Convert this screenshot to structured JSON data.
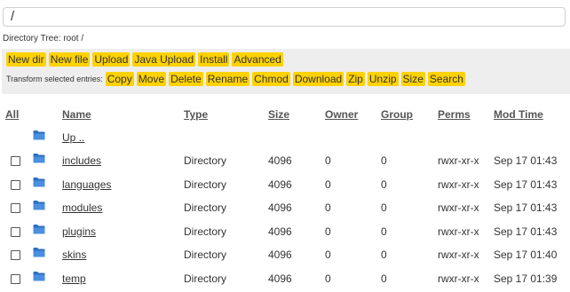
{
  "path": {
    "value": "/"
  },
  "directory_tree": {
    "label": "Directory Tree: root /"
  },
  "toolbar": {
    "row1": [
      "New dir",
      "New file",
      "Upload",
      "Java Upload",
      "Install",
      "Advanced"
    ],
    "transform_label": "Transform selected entries:",
    "row2": [
      "Copy",
      "Move",
      "Delete",
      "Rename",
      "Chmod",
      "Download",
      "Zip",
      "Unzip",
      "Size",
      "Search"
    ]
  },
  "table": {
    "headers": {
      "all": "All",
      "name": "Name",
      "type": "Type",
      "size": "Size",
      "owner": "Owner",
      "group": "Group",
      "perms": "Perms",
      "modtime": "Mod Time"
    },
    "up_label": "Up ..",
    "rows": [
      {
        "name": "includes",
        "type": "Directory",
        "size": "4096",
        "owner": "0",
        "group": "0",
        "perms": "rwxr-xr-x",
        "modtime": "Sep 17 01:43"
      },
      {
        "name": "languages",
        "type": "Directory",
        "size": "4096",
        "owner": "0",
        "group": "0",
        "perms": "rwxr-xr-x",
        "modtime": "Sep 17 01:43"
      },
      {
        "name": "modules",
        "type": "Directory",
        "size": "4096",
        "owner": "0",
        "group": "0",
        "perms": "rwxr-xr-x",
        "modtime": "Sep 17 01:43"
      },
      {
        "name": "plugins",
        "type": "Directory",
        "size": "4096",
        "owner": "0",
        "group": "0",
        "perms": "rwxr-xr-x",
        "modtime": "Sep 17 01:43"
      },
      {
        "name": "skins",
        "type": "Directory",
        "size": "4096",
        "owner": "0",
        "group": "0",
        "perms": "rwxr-xr-x",
        "modtime": "Sep 17 01:40"
      },
      {
        "name": "temp",
        "type": "Directory",
        "size": "4096",
        "owner": "0",
        "group": "0",
        "perms": "rwxr-xr-x",
        "modtime": "Sep 17 01:39"
      }
    ]
  },
  "colors": {
    "button_bg": "#ffd200",
    "toolbar_bg": "#eeeeee",
    "folder_icon": "#2e6fc0"
  },
  "icons": {
    "folder": "folder-icon"
  }
}
